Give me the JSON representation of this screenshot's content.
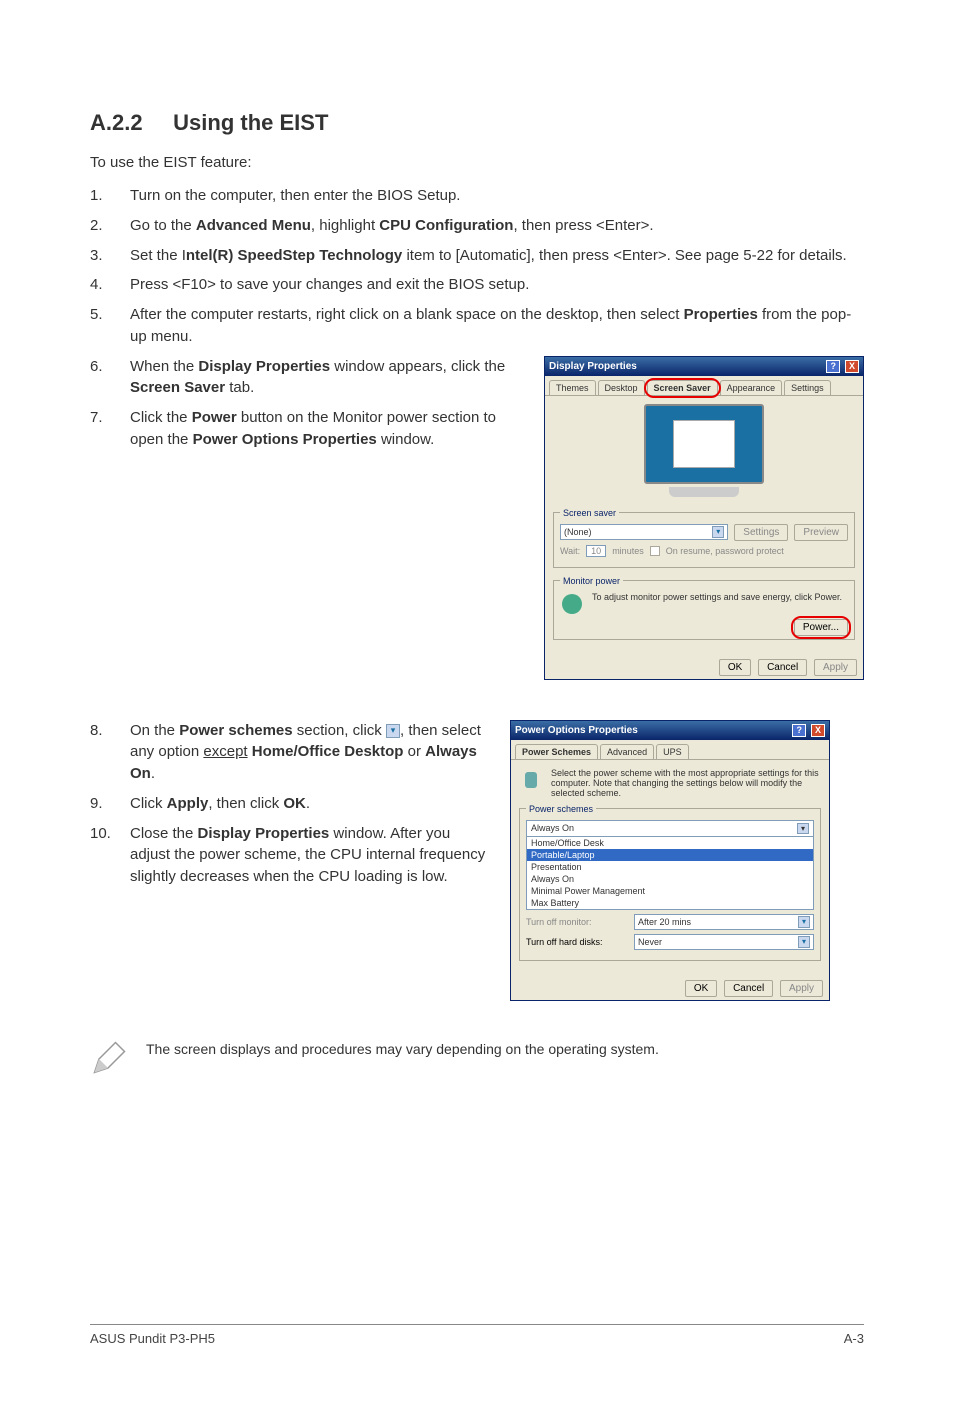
{
  "header": {
    "section_no": "A.2.2",
    "section_title": "Using the EIST"
  },
  "intro": "To use the EIST feature:",
  "steps": {
    "s1_num": "1.",
    "s1": "Turn on the computer, then enter the BIOS Setup.",
    "s2_num": "2.",
    "s2_a": "Go to the ",
    "s2_b": "Advanced Menu",
    "s2_c": ", highlight ",
    "s2_d": "CPU Configuration",
    "s2_e": ", then press <Enter>.",
    "s3_num": "3.",
    "s3_a": "Set the I",
    "s3_b": "ntel(R) SpeedStep Technology",
    "s3_c": " item to [Automatic], then press <Enter>. See page 5-22 for details.",
    "s4_num": "4.",
    "s4": "Press <F10> to save your changes and exit the BIOS setup.",
    "s5_num": "5.",
    "s5_a": "After the computer restarts, right click on a blank space on the desktop, then select ",
    "s5_b": "Properties",
    "s5_c": " from the pop-up menu.",
    "s6_num": "6.",
    "s6_a": "When the ",
    "s6_b": "Display Properties",
    "s6_c": " window appears, click the ",
    "s6_d": "Screen Saver",
    "s6_e": " tab.",
    "s7_num": "7.",
    "s7_a": "Click the ",
    "s7_b": "Power",
    "s7_c": " button on the Monitor power section to open the ",
    "s7_d": "Power Options Properties",
    "s7_e": " window.",
    "s8_num": "8.",
    "s8_a": "On the ",
    "s8_b": "Power schemes",
    "s8_c": " section, click ",
    "s8_d": ", then select any option ",
    "s8_e": "except",
    "s8_f": "Home/Office Desktop",
    "s8_g": " or ",
    "s8_h": "Always On",
    "s8_i": ".",
    "s9_num": "9.",
    "s9_a": "Click ",
    "s9_b": "Apply",
    "s9_c": ", then click ",
    "s9_d": "OK",
    "s9_e": ".",
    "s10_num": "10.",
    "s10_a": "Close the ",
    "s10_b": "Display Properties",
    "s10_c": " window. After you adjust the power scheme, the CPU internal frequency slightly decreases when the CPU loading is low."
  },
  "display_props": {
    "title": "Display Properties",
    "help_btn": "?",
    "close_btn": "X",
    "tabs": {
      "themes": "Themes",
      "desktop": "Desktop",
      "screensaver": "Screen Saver",
      "appearance": "Appearance",
      "settings": "Settings"
    },
    "screensaver_legend": "Screen saver",
    "screensaver_value": "(None)",
    "settings_btn": "Settings",
    "preview_btn": "Preview",
    "wait_label": "Wait:",
    "wait_value": "10",
    "wait_unit": "minutes",
    "resume_label": "On resume, password protect",
    "monitor_legend": "Monitor power",
    "monitor_text": "To adjust monitor power settings and save energy, click Power.",
    "power_btn": "Power...",
    "ok": "OK",
    "cancel": "Cancel",
    "apply": "Apply"
  },
  "power_opts": {
    "title": "Power Options Properties",
    "help_btn": "?",
    "close_btn": "X",
    "tabs": {
      "schemes": "Power Schemes",
      "advanced": "Advanced",
      "ups": "UPS"
    },
    "description": "Select the power scheme with the most appropriate settings for this computer. Note that changing the settings below will modify the selected scheme.",
    "schemes_legend": "Power schemes",
    "scheme_current": "Always On",
    "scheme_options": {
      "o1": "Home/Office Desk",
      "o2": "Portable/Laptop",
      "o3": "Presentation",
      "o4": "Always On",
      "o5": "Minimal Power Management",
      "o6": "Max Battery"
    },
    "turnoff_monitor_label": "Turn off monitor:",
    "turnoff_monitor_value": "After 20 mins",
    "turnoff_hd_label": "Turn off hard disks:",
    "turnoff_hd_value": "Never",
    "ok": "OK",
    "cancel": "Cancel",
    "apply": "Apply"
  },
  "note": "The screen displays and procedures may vary depending on the operating system.",
  "footer": {
    "left": "ASUS Pundit P3-PH5",
    "right": "A-3"
  }
}
